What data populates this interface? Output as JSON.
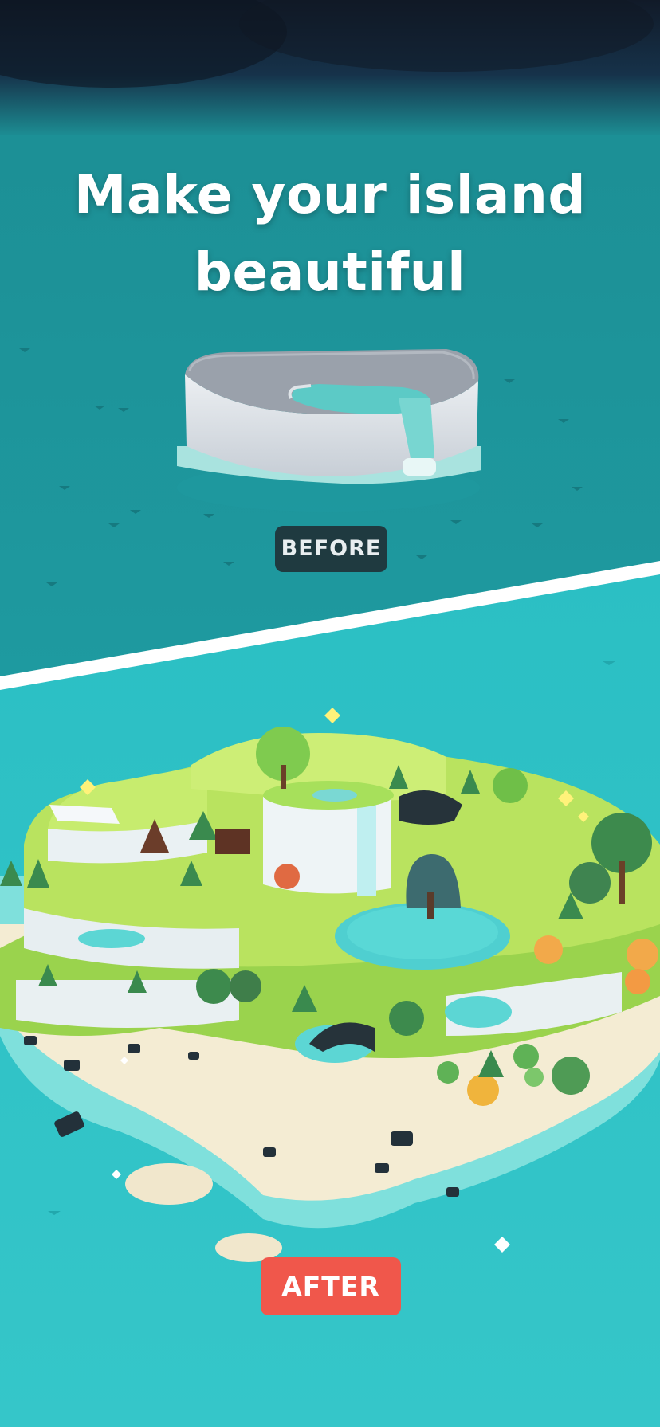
{
  "headline": {
    "line1": "Make your island",
    "line2": "beautiful"
  },
  "labels": {
    "before": "BEFORE",
    "after": "AFTER"
  },
  "colors": {
    "sky_dark": "#121c2a",
    "sea_before": "#1c8d93",
    "sea_after": "#29bfc4",
    "before_badge_bg": "#1f3a40",
    "after_badge_bg": "#f0574b",
    "divider": "#ffffff"
  }
}
